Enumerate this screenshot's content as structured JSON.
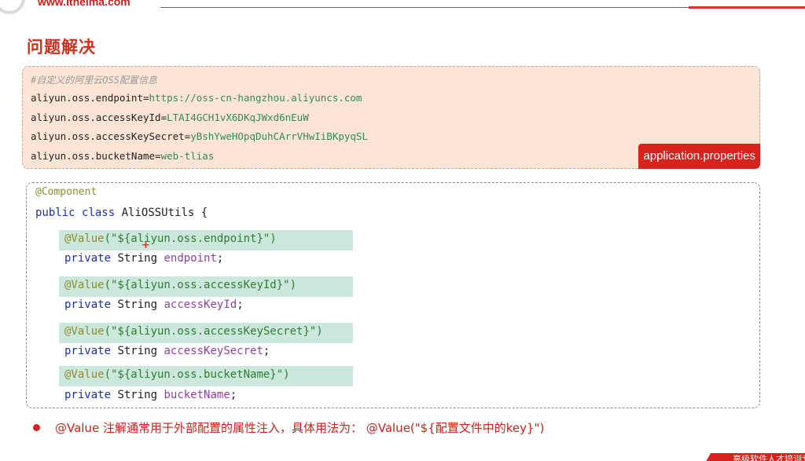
{
  "header": {
    "site_url": "www.itheima.com"
  },
  "page_title": "问题解决",
  "properties": {
    "comment": "#自定义的阿里云OSS配置信息",
    "entries": [
      {
        "key": "aliyun.oss.endpoint",
        "value": "https://oss-cn-hangzhou.aliyuncs.com"
      },
      {
        "key": "aliyun.oss.accessKeyId",
        "value": "LTAI4GCH1vX6DKqJWxd6nEuW"
      },
      {
        "key": "aliyun.oss.accessKeySecret",
        "value": "yBshYweHOpqDuhCArrVHwIiBKpyqSL"
      },
      {
        "key": "aliyun.oss.bucketName",
        "value": "web-tlias"
      }
    ],
    "file_label": "application.properties"
  },
  "code": {
    "class_annotation": "@Component",
    "class_decl_kw1": "public",
    "class_decl_kw2": "class",
    "class_name": "AliOSSUtils {",
    "fields": [
      {
        "annotation": "@Value",
        "key_string": "(\"${aliyun.oss.endpoint}\")",
        "modifier": "private",
        "type": "String",
        "name": "endpoint",
        "end": ";"
      },
      {
        "annotation": "@Value",
        "key_string": "(\"${aliyun.oss.accessKeyId}\")",
        "modifier": "private",
        "type": "String",
        "name": "accessKeyId",
        "end": ";"
      },
      {
        "annotation": "@Value",
        "key_string": "(\"${aliyun.oss.accessKeySecret}\")",
        "modifier": "private",
        "type": "String",
        "name": "accessKeySecret",
        "end": ";"
      },
      {
        "annotation": "@Value",
        "key_string": "(\"${aliyun.oss.bucketName}\")",
        "modifier": "private",
        "type": "String",
        "name": "bucketName",
        "end": ";"
      }
    ]
  },
  "note": "@Value 注解通常用于外部配置的属性注入，具体用法为： @Value(\"${配置文件中的key}\")",
  "bottom_tab": "高级软件人才培训专家",
  "colors": {
    "accent_red": "#d8231d",
    "props_bg": "#fde4d5",
    "annotation_highlight": "#cce8dc"
  }
}
